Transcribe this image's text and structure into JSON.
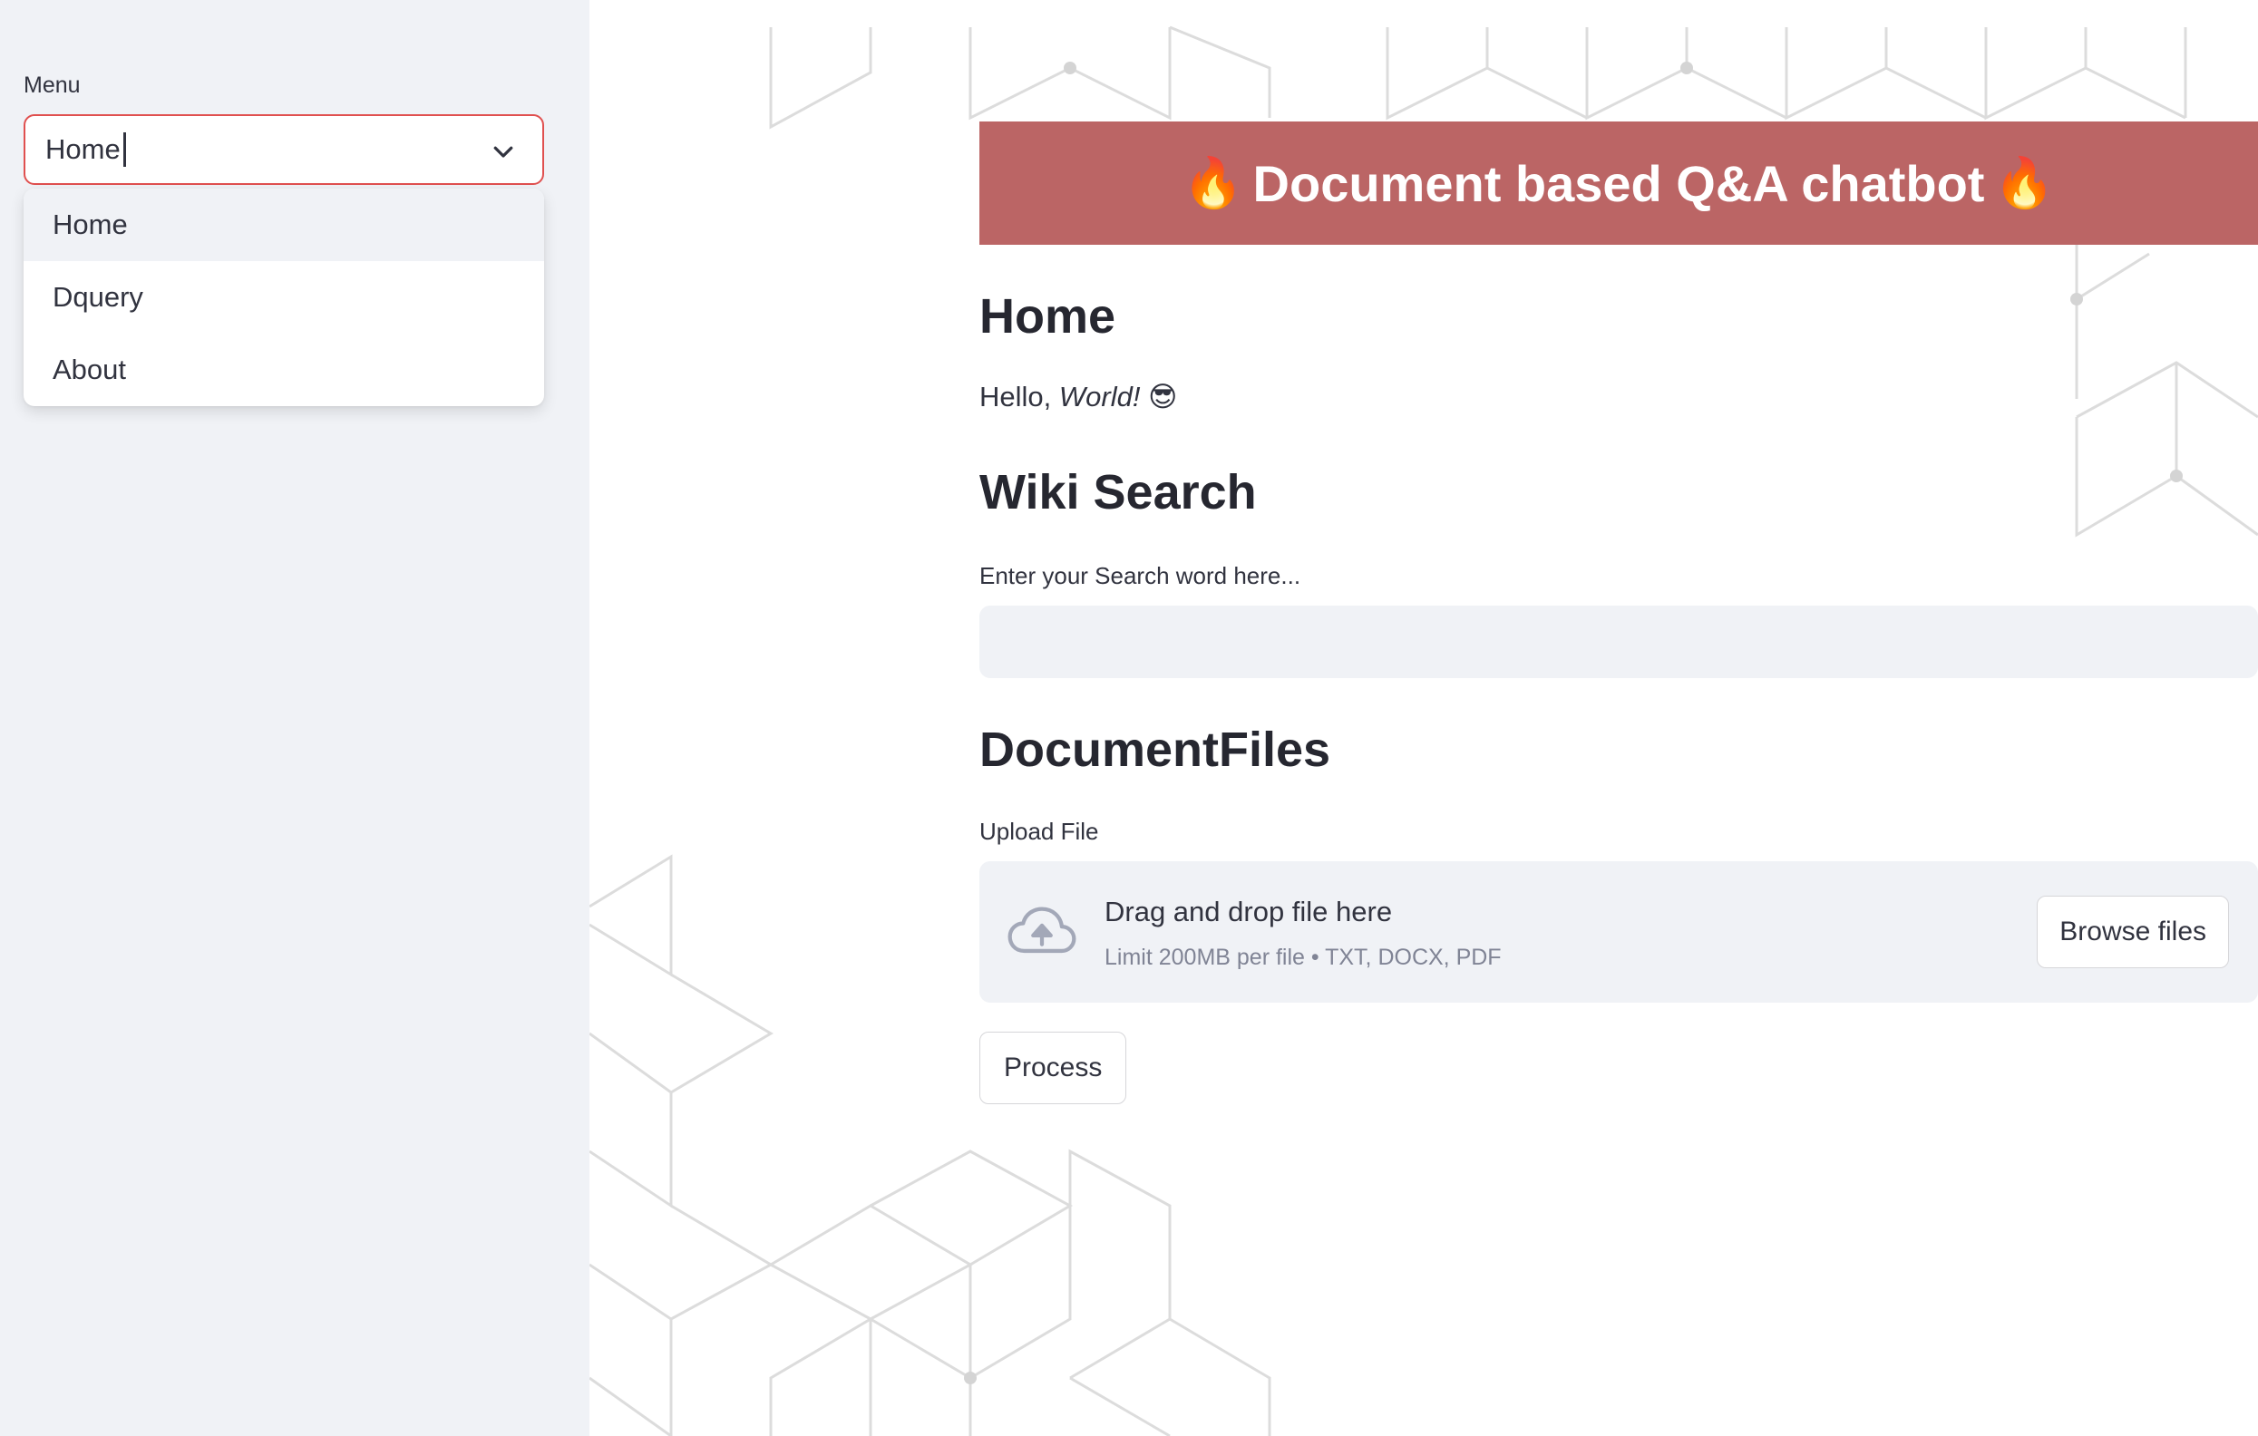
{
  "sidebar": {
    "menu_label": "Menu",
    "select_value": "Home",
    "options": [
      {
        "label": "Home"
      },
      {
        "label": "Dquery"
      },
      {
        "label": "About"
      }
    ]
  },
  "banner": {
    "title": "Document based Q&A chatbot",
    "emoji": "🔥",
    "color": "#bb6565"
  },
  "home": {
    "heading": "Home",
    "hello_prefix": "Hello, ",
    "hello_em": "World!",
    "hello_emoji": "😎"
  },
  "wiki": {
    "heading": "Wiki Search",
    "label": "Enter your Search word here...",
    "value": ""
  },
  "docs": {
    "heading": "DocumentFiles",
    "upload_label": "Upload File",
    "drop_title": "Drag and drop file here",
    "drop_subtitle": "Limit 200MB per file • TXT, DOCX, PDF",
    "browse_label": "Browse files"
  },
  "process_label": "Process",
  "icons": {
    "chevron": "chevron-down-icon",
    "upload": "cloud-upload-icon"
  },
  "colors": {
    "accent": "#e0504f",
    "sidebar_bg": "#f0f2f6",
    "text": "#31333f",
    "muted": "#808495"
  }
}
